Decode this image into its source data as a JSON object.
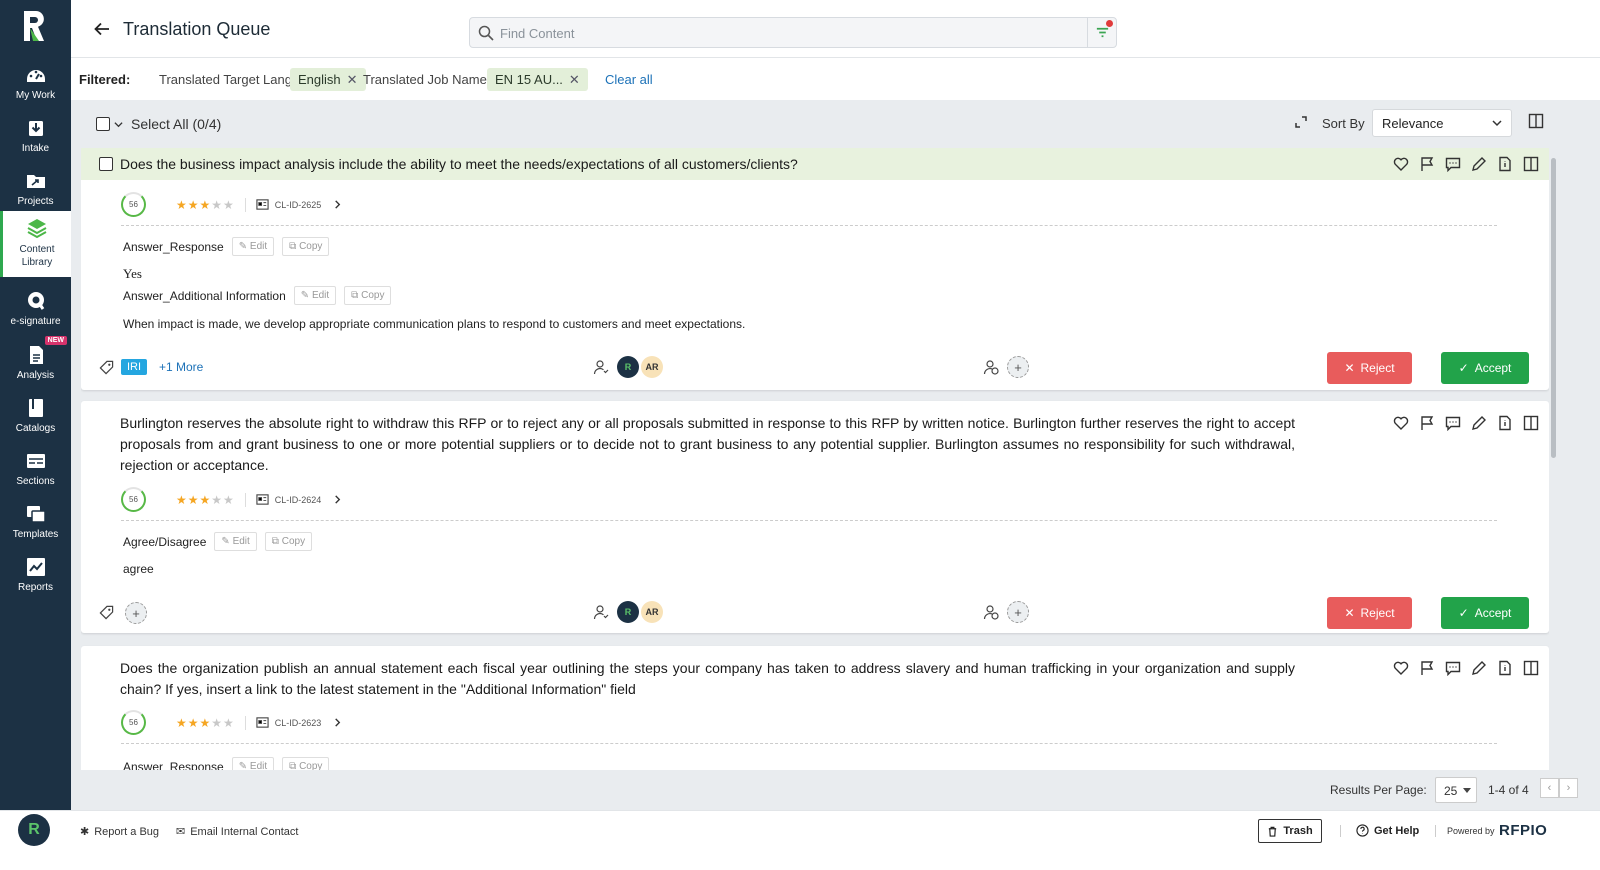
{
  "header": {
    "title": "Translation Queue",
    "search_placeholder": "Find Content"
  },
  "sidebar": {
    "items": [
      {
        "label": "My Work",
        "icon": "dashboard-icon"
      },
      {
        "label": "Intake",
        "icon": "download-icon"
      },
      {
        "label": "Projects",
        "icon": "folder-icon"
      },
      {
        "label": "Content Library",
        "icon": "layers-icon",
        "active": true
      },
      {
        "label": "e-signature",
        "icon": "signature-icon"
      },
      {
        "label": "Analysis",
        "icon": "document-icon",
        "badge": "NEW"
      },
      {
        "label": "Catalogs",
        "icon": "book-icon"
      },
      {
        "label": "Sections",
        "icon": "sections-icon"
      },
      {
        "label": "Templates",
        "icon": "templates-icon"
      },
      {
        "label": "Reports",
        "icon": "chart-icon"
      }
    ]
  },
  "filters": {
    "label": "Filtered:",
    "f1_name": "Translated Target Language:",
    "f1_value": "English",
    "f2_name": "Translated Job Name:",
    "f2_value": "EN 15 AU...",
    "clear": "Clear all"
  },
  "toolbar": {
    "select_all": "Select All (0/4)",
    "sort_label": "Sort By",
    "sort_value": "Relevance"
  },
  "cards": [
    {
      "question": "Does the business impact analysis include the ability to meet the needs/expectations of all customers/clients?",
      "score": "56",
      "rating": 3,
      "id": "CL-ID-2625",
      "fields": [
        {
          "name": "Answer_Response",
          "value": "Yes"
        },
        {
          "name": "Answer_Additional Information",
          "value": "When impact is made, we develop appropriate communication plans to respond to customers and meet expectations."
        }
      ],
      "tag": "IRI",
      "more": "+1 More",
      "owner_initials": "AR"
    },
    {
      "question": "Burlington reserves the absolute right to withdraw this RFP or to reject any or all proposals submitted in response to this RFP by written notice. Burlington further reserves the right to accept proposals from and grant business to one or more potential suppliers or to decide not to grant business to any potential supplier. Burlington assumes no responsibility for such withdrawal, rejection or acceptance.",
      "score": "56",
      "rating": 3,
      "id": "CL-ID-2624",
      "fields": [
        {
          "name": "Agree/Disagree",
          "value": "agree"
        }
      ],
      "owner_initials": "AR"
    },
    {
      "question": "Does the organization publish an annual statement each fiscal year outlining the steps your company has taken to address slavery and human trafficking in your organization and supply chain? If yes, insert a link to the latest statement in the \"Additional Information\" field",
      "score": "56",
      "rating": 3,
      "id": "CL-ID-2623",
      "fields": [
        {
          "name": "Answer_Response",
          "value": ""
        }
      ]
    }
  ],
  "common": {
    "edit": "Edit",
    "copy": "Copy",
    "reject": "Reject",
    "accept": "Accept",
    "plus": "+"
  },
  "pager": {
    "label": "Results Per Page:",
    "per_page": "25",
    "range": "1-4 of 4"
  },
  "footer": {
    "report_bug": "Report a Bug",
    "email_contact": "Email Internal Contact",
    "trash": "Trash",
    "help": "Get Help",
    "powered": "Powered by",
    "brand": "RFPIO"
  },
  "colors": {
    "sidebar": "#1c3144",
    "accent_green": "#22a34a",
    "reject_red": "#e85c5c",
    "link": "#1d72b8",
    "highlight": "#e8f2de"
  }
}
